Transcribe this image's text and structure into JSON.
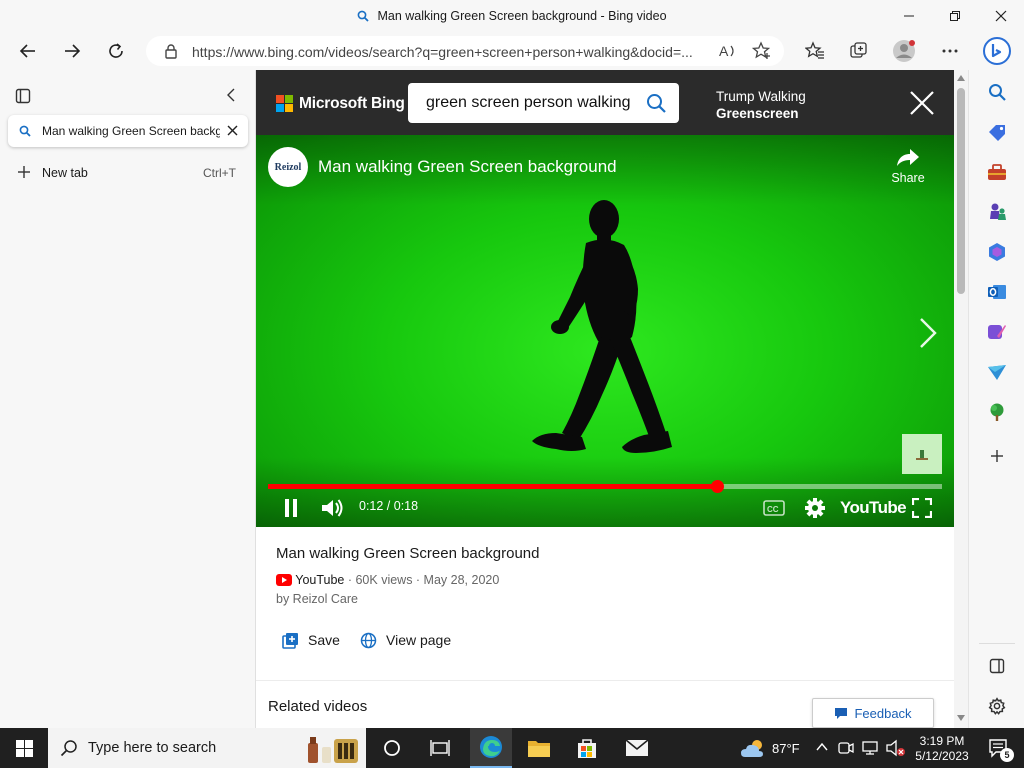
{
  "window": {
    "title": "Man walking Green Screen background - Bing video"
  },
  "address_bar": {
    "url": "https://www.bing.com/videos/search?q=green+screen+person+walking&docid=..."
  },
  "tabs_panel": {
    "active_tab_label": "Man walking Green Screen background - Bing video",
    "new_tab_label": "New tab",
    "new_tab_shortcut": "Ctrl+T"
  },
  "bing_header": {
    "logo_text": "Microsoft Bing",
    "search_value": "green screen person walking",
    "next_video_line1": "Trump Walking",
    "next_video_line2": "Greenscreen"
  },
  "player": {
    "channel_logo_text": "Reizol",
    "title": "Man walking Green Screen background",
    "share_label": "Share",
    "time_current": "0:12",
    "time_total": "0:18",
    "time_display": "0:12 / 0:18",
    "progress_fraction": 0.6667,
    "youtube_label": "YouTube"
  },
  "video_info": {
    "title": "Man walking Green Screen background",
    "source": "YouTube",
    "meta": " · 60K views · May 28, 2020",
    "by": "by Reizol Care",
    "save_label": "Save",
    "view_page_label": "View page"
  },
  "related_heading": "Related videos",
  "feedback_label": "Feedback",
  "taskbar": {
    "search_placeholder": "Type here to search",
    "temperature": "87°F",
    "time": "3:19 PM",
    "date": "5/12/2023",
    "notification_count": "5"
  },
  "colors": {
    "accent": "#0078d4",
    "progress": "#ff0000",
    "greenscreen": "#19c90f",
    "bing_header": "#2b2b2b"
  }
}
